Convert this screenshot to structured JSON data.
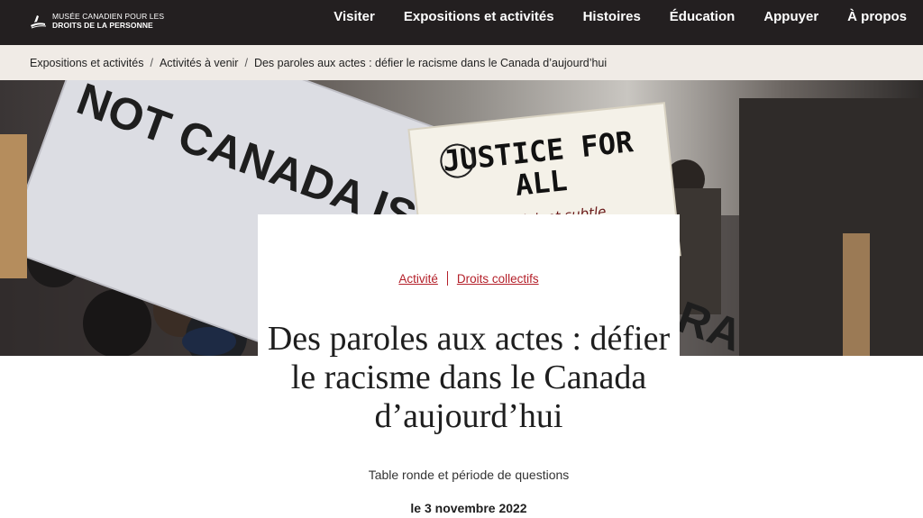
{
  "header": {
    "logo_line1": "MUSÉE CANADIEN POUR LES",
    "logo_line2": "DROITS DE LA PERSONNE",
    "nav": [
      {
        "label": "Visiter"
      },
      {
        "label": "Expositions et activités"
      },
      {
        "label": "Histoires"
      },
      {
        "label": "Éducation"
      },
      {
        "label": "Appuyer"
      },
      {
        "label": "À propos"
      }
    ]
  },
  "breadcrumb": {
    "items": [
      {
        "label": "Expositions et activités"
      },
      {
        "label": "Activités à venir"
      },
      {
        "label": "Des paroles aux actes : défier le racisme dans le Canada d’aujourd’hui"
      }
    ],
    "separator": "/"
  },
  "hero": {
    "sign1": "NOT CANADA IS IMMUNE TO RACISM",
    "sign2_line1": "JUSTICE FOR",
    "sign2_line2": "ALL",
    "sign2_line3": "end Violent  subtle"
  },
  "card": {
    "tags": [
      {
        "label": "Activité"
      },
      {
        "label": "Droits collectifs"
      }
    ],
    "title": "Des paroles aux actes : défier le racisme dans le Canada d’aujourd’hui",
    "subtitle": "Table ronde et période de questions",
    "date": "le 3 novembre 2022"
  },
  "colors": {
    "nav_bg": "#231f20",
    "breadcrumb_bg": "#f0ebe6",
    "accent": "#b4202a"
  }
}
